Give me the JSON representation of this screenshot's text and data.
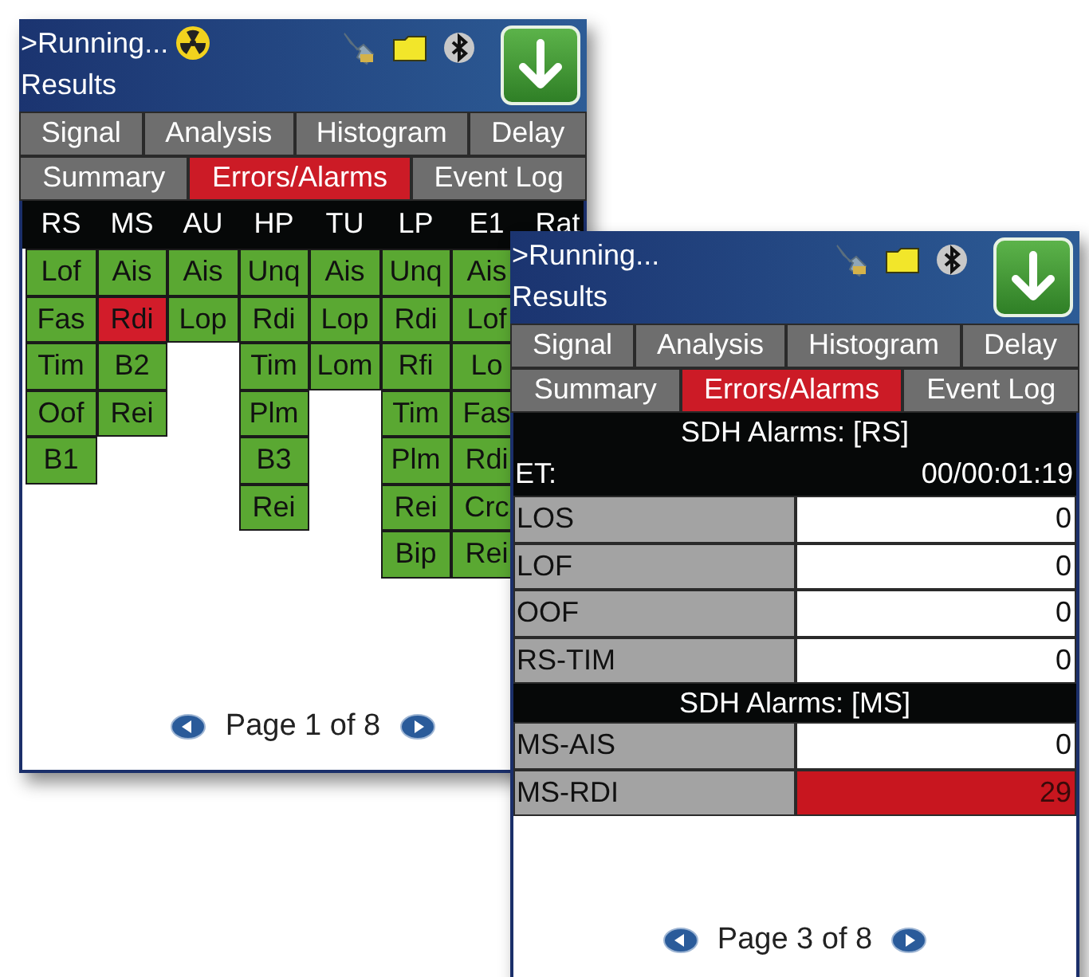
{
  "screens": [
    {
      "status": ">Running...",
      "busy": true,
      "title": "Results",
      "tab_rows": [
        [
          {
            "label": "Signal",
            "selected": false
          },
          {
            "label": "Analysis",
            "selected": false
          },
          {
            "label": "Histogram",
            "selected": false
          },
          {
            "label": "Delay",
            "selected": false
          }
        ],
        [
          {
            "label": "Summary",
            "selected": false
          },
          {
            "label": "Errors/Alarms",
            "selected": true
          },
          {
            "label": "Event Log",
            "selected": false
          }
        ]
      ],
      "content": {
        "kind": "grid",
        "columns": [
          {
            "header": "RS",
            "cells": [
              {
                "text": "Lof",
                "alarm": false
              },
              {
                "text": "Fas",
                "alarm": false
              },
              {
                "text": "Tim",
                "alarm": false
              },
              {
                "text": "Oof",
                "alarm": false
              },
              {
                "text": "B1",
                "alarm": false
              }
            ]
          },
          {
            "header": "MS",
            "cells": [
              {
                "text": "Ais",
                "alarm": false
              },
              {
                "text": "Rdi",
                "alarm": true
              },
              {
                "text": "B2",
                "alarm": false
              },
              {
                "text": "Rei",
                "alarm": false
              }
            ]
          },
          {
            "header": "AU",
            "cells": [
              {
                "text": "Ais",
                "alarm": false
              },
              {
                "text": "Lop",
                "alarm": false
              }
            ]
          },
          {
            "header": "HP",
            "cells": [
              {
                "text": "Unq",
                "alarm": false
              },
              {
                "text": "Rdi",
                "alarm": false
              },
              {
                "text": "Tim",
                "alarm": false
              },
              {
                "text": "Plm",
                "alarm": false
              },
              {
                "text": "B3",
                "alarm": false
              },
              {
                "text": "Rei",
                "alarm": false
              }
            ]
          },
          {
            "header": "TU",
            "cells": [
              {
                "text": "Ais",
                "alarm": false
              },
              {
                "text": "Lop",
                "alarm": false
              },
              {
                "text": "Lom",
                "alarm": false
              }
            ]
          },
          {
            "header": "LP",
            "cells": [
              {
                "text": "Unq",
                "alarm": false
              },
              {
                "text": "Rdi",
                "alarm": false
              },
              {
                "text": "Rfi",
                "alarm": false
              },
              {
                "text": "Tim",
                "alarm": false
              },
              {
                "text": "Plm",
                "alarm": false
              },
              {
                "text": "Rei",
                "alarm": false
              },
              {
                "text": "Bip",
                "alarm": false
              }
            ]
          },
          {
            "header": "E1",
            "cells": [
              {
                "text": "Ais",
                "alarm": false
              },
              {
                "text": "Lof",
                "alarm": false
              },
              {
                "text": "Lo",
                "alarm": false
              },
              {
                "text": "Fas",
                "alarm": false
              },
              {
                "text": "Rdi",
                "alarm": false
              },
              {
                "text": "Crc",
                "alarm": false
              },
              {
                "text": "Rei",
                "alarm": false
              }
            ]
          },
          {
            "header": "Rat"
          }
        ]
      },
      "pager": "Page 1 of 8"
    },
    {
      "status": ">Running...",
      "busy": false,
      "title": "Results",
      "tab_rows": [
        [
          {
            "label": "Signal",
            "selected": false
          },
          {
            "label": "Analysis",
            "selected": false
          },
          {
            "label": "Histogram",
            "selected": false
          },
          {
            "label": "Delay",
            "selected": false
          }
        ],
        [
          {
            "label": "Summary",
            "selected": false
          },
          {
            "label": "Errors/Alarms",
            "selected": true
          },
          {
            "label": "Event Log",
            "selected": false
          }
        ]
      ],
      "content": {
        "kind": "table",
        "sections": [
          {
            "heading": "SDH Alarms: [RS]",
            "elapsed_label": "ET:",
            "elapsed": "00/00:01:19",
            "rows": [
              {
                "label": "LOS",
                "value": "0",
                "alarm": false
              },
              {
                "label": "LOF",
                "value": "0",
                "alarm": false
              },
              {
                "label": "OOF",
                "value": "0",
                "alarm": false
              },
              {
                "label": "RS-TIM",
                "value": "0",
                "alarm": false
              }
            ]
          },
          {
            "heading": "SDH Alarms: [MS]",
            "rows": [
              {
                "label": "MS-AIS",
                "value": "0",
                "alarm": false
              },
              {
                "label": "MS-RDI",
                "value": "29",
                "alarm": true
              }
            ]
          }
        ]
      },
      "pager": "Page 3 of 8"
    }
  ]
}
